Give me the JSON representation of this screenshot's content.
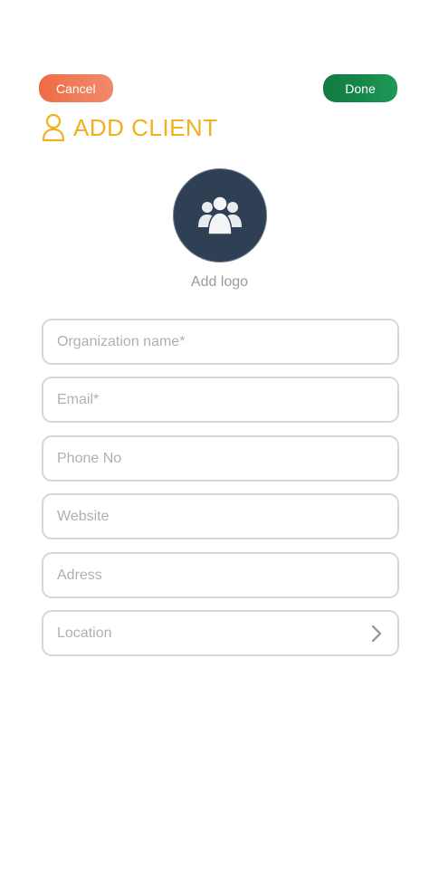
{
  "header": {
    "cancel_label": "Cancel",
    "done_label": "Done",
    "title": "ADD CLIENT",
    "title_icon": "user-outline-icon"
  },
  "logo": {
    "icon": "group-users-icon",
    "add_logo_label": "Add logo"
  },
  "form": {
    "organization_placeholder": "Organization name*",
    "email_placeholder": "Email*",
    "phone_placeholder": "Phone No",
    "website_placeholder": "Website",
    "address_placeholder": "Adress",
    "location_label": "Location",
    "location_icon": "chevron-right-icon"
  },
  "colors": {
    "cancel": "#ef6a44",
    "done": "#137a40",
    "title": "#f2b11a",
    "logo_bg": "#2f4055"
  }
}
